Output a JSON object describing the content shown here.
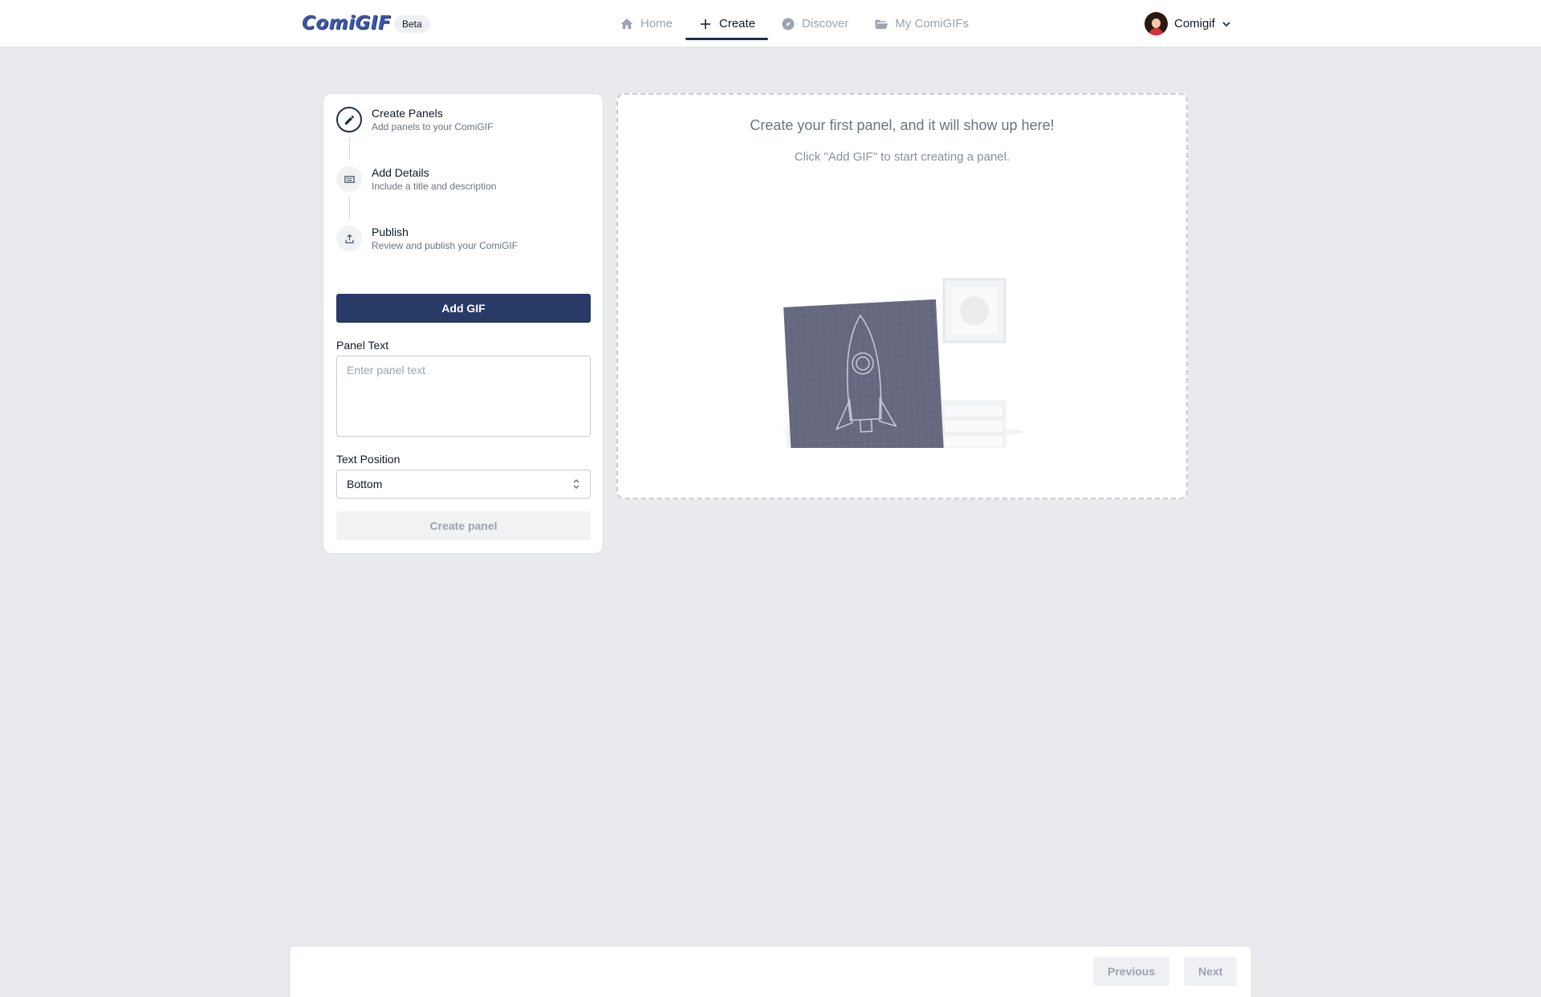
{
  "header": {
    "logo": "ComiGIF",
    "badge": "Beta",
    "nav": [
      {
        "label": "Home",
        "icon": "home-icon"
      },
      {
        "label": "Create",
        "icon": "plus-icon"
      },
      {
        "label": "Discover",
        "icon": "compass-icon"
      },
      {
        "label": "My ComiGIFs",
        "icon": "folder-icon"
      }
    ],
    "active_nav": "Create",
    "user_name": "Comigif"
  },
  "steps": [
    {
      "title": "Create Panels",
      "subtitle": "Add panels to your ComiGIF",
      "icon": "pencil-icon"
    },
    {
      "title": "Add Details",
      "subtitle": "Include a title and description",
      "icon": "keyboard-icon"
    },
    {
      "title": "Publish",
      "subtitle": "Review and publish your ComiGIF",
      "icon": "upload-icon"
    }
  ],
  "form": {
    "add_gif_label": "Add GIF",
    "panel_text_label": "Panel Text",
    "panel_text_placeholder": "Enter panel text",
    "text_position_label": "Text Position",
    "text_position_value": "Bottom",
    "create_panel_label": "Create panel"
  },
  "preview": {
    "title": "Create your first panel, and it will show up here!",
    "subtitle": "Click \"Add GIF\" to start creating a panel."
  },
  "footer": {
    "previous_label": "Previous",
    "next_label": "Next"
  },
  "colors": {
    "accent": "#283a66",
    "background": "#e8eaed"
  }
}
